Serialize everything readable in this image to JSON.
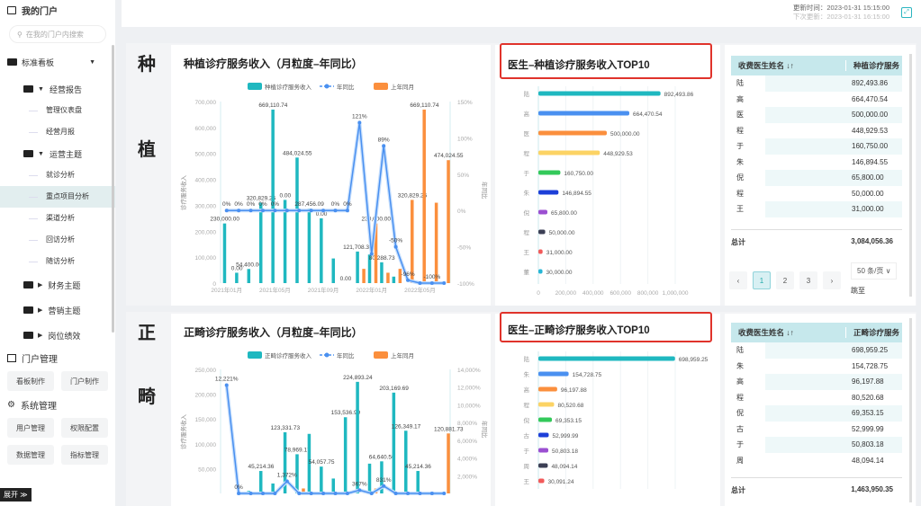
{
  "sidebar": {
    "title": "我的门户",
    "search_placeholder": "在我的门户内搜索",
    "section": "标准看板",
    "groups": [
      {
        "label": "经营报告",
        "items": [
          "管理仪表盘",
          "经营月报"
        ]
      },
      {
        "label": "运营主题",
        "items": [
          "就诊分析",
          "重点项目分析",
          "渠道分析",
          "回访分析",
          "随访分析"
        ]
      }
    ],
    "collapsed": [
      "财务主题",
      "营销主题",
      "岗位绩效"
    ],
    "portal_mgmt": "门户管理",
    "portal_btns": [
      "看板制作",
      "门户制作"
    ],
    "sys_mgmt": "系统管理",
    "sys_btns": [
      "用户管理",
      "权限配置",
      "数据管理",
      "指标管理"
    ],
    "expand": "展开 ≫"
  },
  "header": {
    "update_time": "更新时间：2023-01-31 15:15:00",
    "next_update": "下次更新：2023-01-31 16:15:00"
  },
  "sections": [
    {
      "label1": "种",
      "label2": "植",
      "chart": {
        "title": "种植诊疗服务收入（月粒度–年同比）",
        "legend": [
          "种植诊疗服务收入",
          "年同比",
          "上年同月"
        ],
        "ylabel": "诊疗服务收入",
        "y2label": "年同比"
      },
      "bar_title": "医生–种植诊疗服务收入TOP10",
      "table": {
        "col1": "收费医生姓名 ↓↑",
        "col2": "种植诊疗服务",
        "rows": [
          [
            "陆",
            "892,493.86"
          ],
          [
            "高",
            "664,470.54"
          ],
          [
            "医",
            "500,000.00"
          ],
          [
            "程",
            "448,929.53"
          ],
          [
            "于",
            "160,750.00"
          ],
          [
            "朱",
            "146,894.55"
          ],
          [
            "倪",
            "65,800.00"
          ],
          [
            "程",
            "50,000.00"
          ],
          [
            "王",
            "31,000.00"
          ]
        ],
        "total_label": "总计",
        "total": "3,084,056.36",
        "pages": [
          "1",
          "2",
          "3"
        ],
        "page_size": "50 条/页",
        "jump": "跳至"
      }
    },
    {
      "label1": "正",
      "label2": "畸",
      "chart": {
        "title": "正畸诊疗服务收入（月粒度–年同比）",
        "legend": [
          "正畸诊疗服务收入",
          "年同比",
          "上年同月"
        ],
        "ylabel": "诊疗服务收入",
        "y2label": "年同比"
      },
      "bar_title": "医生–正畸诊疗服务收入TOP10",
      "table": {
        "col1": "收费医生姓名 ↓↑",
        "col2": "正畸诊疗服务",
        "rows": [
          [
            "陆",
            "698,959.25"
          ],
          [
            "朱",
            "154,728.75"
          ],
          [
            "高",
            "96,197.88"
          ],
          [
            "程",
            "80,520.68"
          ],
          [
            "倪",
            "69,353.15"
          ],
          [
            "古",
            "52,999.99"
          ],
          [
            "于",
            "50,803.18"
          ],
          [
            "周",
            "48,094.14"
          ]
        ],
        "total_label": "总计",
        "total": "1,463,950.35"
      }
    }
  ],
  "chart_data": [
    {
      "type": "bar",
      "title": "种植诊疗服务收入（月粒度–年同比）",
      "ylim": [
        0,
        700000
      ],
      "y2lim": [
        -100,
        150
      ],
      "yticks": [
        "0",
        "100,000",
        "200,000",
        "300,000",
        "400,000",
        "500,000",
        "600,000",
        "700,000"
      ],
      "y2ticks": [
        "-100%",
        "-50%",
        "0%",
        "50%",
        "100%",
        "150%"
      ],
      "xticks": [
        "2021年01月",
        "2021年05月",
        "2021年09月",
        "2022年01月",
        "2022年05月"
      ],
      "series": [
        {
          "name": "种植诊疗服务收入",
          "values": [
            230000,
            40000,
            54400,
            310000,
            669110.74,
            320829.25,
            484024.55,
            287456.09,
            250000,
            95000,
            0,
            121708.3,
            110000,
            80288.73,
            25000,
            0,
            0,
            0,
            0
          ],
          "labels": [
            "230,000.00",
            "0.00",
            "54,400.00",
            "320,829.25",
            "669,110.74",
            "0.00",
            "484,024.55",
            "287,456.09",
            "0.00",
            "",
            "0.00",
            "121,708.30",
            "",
            "80,288.73",
            "",
            "",
            "",
            "",
            ""
          ]
        },
        {
          "name": "上年同月",
          "values": [
            0,
            0,
            0,
            0,
            0,
            0,
            0,
            0,
            0,
            0,
            0,
            55000,
            230000,
            40000,
            55000,
            320829.25,
            669110.74,
            310000,
            474024.55
          ],
          "labels": [
            "",
            "",
            "",
            "",
            "",
            "",
            "",
            "",
            "",
            "",
            "",
            "",
            "230,000.00",
            "",
            "",
            "320,829.25",
            "669,110.74",
            "",
            "474,024.55"
          ]
        },
        {
          "name": "年同比",
          "values": [
            0,
            0,
            0,
            0,
            0,
            0,
            0,
            0,
            0,
            0,
            0,
            121,
            -60,
            89,
            -50,
            -96,
            -100,
            -100,
            -100
          ],
          "labels": [
            "0%",
            "0%",
            "0%",
            "0%",
            "0%",
            "",
            "",
            "",
            "",
            "0%",
            "0%",
            "121%",
            "",
            "89%",
            "-50%",
            "-96%",
            "",
            "-100%",
            ""
          ]
        }
      ]
    },
    {
      "type": "bar",
      "title": "医生–种植诊疗服务收入TOP10",
      "xlim": [
        0,
        1000000
      ],
      "xticks": [
        "0",
        "200,000",
        "400,000",
        "600,000",
        "800,000",
        "1,000,000"
      ],
      "categories": [
        "陆",
        "高",
        "医",
        "程",
        "于",
        "朱",
        "倪",
        "程",
        "王",
        "董"
      ],
      "values": [
        892493.86,
        664470.54,
        500000,
        448929.53,
        160750,
        146894.55,
        65800,
        50000,
        31000,
        30000
      ],
      "labels": [
        "892,493.86",
        "664,470.54",
        "500,000.00",
        "448,929.53",
        "160,750.00",
        "146,894.55",
        "65,800.00",
        "50,000.00",
        "31,000.00",
        "30,000.00"
      ]
    },
    {
      "type": "bar",
      "title": "正畸诊疗服务收入（月粒度–年同比）",
      "ylim": [
        0,
        250000
      ],
      "y2lim": [
        0,
        14000
      ],
      "yticks": [
        "50,000",
        "100,000",
        "150,000",
        "200,000",
        "250,000"
      ],
      "y2ticks": [
        "2,000%",
        "4,000%",
        "6,000%",
        "8,000%",
        "10,000%",
        "12,000%",
        "14,000%"
      ],
      "series": [
        {
          "name": "正畸诊疗服务收入",
          "values": [
            0,
            0,
            5000,
            45214.36,
            20000,
            123331.73,
            78969.17,
            120000,
            54057.75,
            30000,
            153536.99,
            224893.24,
            60000,
            64640.56,
            203169.69,
            126349.17,
            45214.36,
            0,
            0
          ],
          "labels": [
            "",
            "",
            "",
            "45,214.36",
            "",
            "123,331.73",
            "78,969.17",
            "",
            "54,057.75",
            "",
            "153,536.99",
            "224,893.24",
            "",
            "64,640.56",
            "203,169.69",
            "126,349.17",
            "45,214.36",
            "",
            ""
          ]
        },
        {
          "name": "上年同月",
          "values": [
            0,
            0,
            0,
            0,
            0,
            0,
            10000,
            0,
            0,
            0,
            0,
            0,
            10000,
            0,
            0,
            0,
            0,
            0,
            120881.73
          ],
          "labels": [
            "",
            "",
            "",
            "",
            "",
            "",
            "",
            "",
            "",
            "",
            "",
            "",
            "",
            "",
            "",
            "",
            "",
            "",
            "120,881.73"
          ]
        },
        {
          "name": "年同比",
          "values": [
            12221,
            0,
            0,
            0,
            0,
            1372,
            0,
            0,
            0,
            0,
            0,
            367,
            0,
            831,
            0,
            0,
            0,
            0,
            0
          ],
          "labels": [
            "12,221%",
            "0%",
            "",
            "",
            "",
            "1,372%",
            "",
            "",
            "",
            "",
            "",
            "367%",
            "",
            "831%",
            "",
            "",
            "",
            "",
            ""
          ]
        }
      ]
    },
    {
      "type": "bar",
      "title": "医生–正畸诊疗服务收入TOP10",
      "xlim": [
        0,
        700000
      ],
      "categories": [
        "陆",
        "朱",
        "高",
        "程",
        "倪",
        "古",
        "于",
        "周",
        "王"
      ],
      "values": [
        698959.25,
        154728.75,
        96197.88,
        80520.68,
        69353.15,
        52999.99,
        50803.18,
        48094.14,
        30091.24
      ],
      "labels": [
        "698,959.25",
        "154,728.75",
        "96,197.88",
        "80,520.68",
        "69,353.15",
        "52,999.99",
        "50,803.18",
        "48,094.14",
        "30,091.24"
      ]
    }
  ],
  "colors": {
    "teal": "#1fb8c0",
    "blue": "#4a90f0",
    "orange": "#fb8f3d",
    "bars": [
      "#1fb8c0",
      "#4a90f0",
      "#fb8f3d",
      "#fcd364",
      "#33c95a",
      "#1d3fd8",
      "#9b4fd1",
      "#3c3f55",
      "#f25a5a",
      "#27b6d6"
    ]
  }
}
